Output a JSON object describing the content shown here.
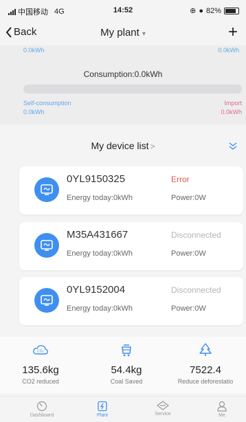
{
  "status_bar": {
    "carrier": "中国移动",
    "network": "4G",
    "time": "14:52",
    "battery": "82%",
    "battery_level": 0.82
  },
  "nav": {
    "back_label": "Back",
    "title": "My plant",
    "plus": "+"
  },
  "summary": {
    "top_left_value": "0.0kWh",
    "top_right_value": "0.0kWh",
    "consumption": "Consumption:0.0kWh",
    "self_consumption_label": "Self-consumption",
    "self_consumption_value": "0.0kWh",
    "import_label": "Import",
    "import_value": "0.0kWh",
    "colors": {
      "blue": "#5fa8e6",
      "pink": "#e06a8a"
    }
  },
  "device_list": {
    "title": "My device list",
    "chevron": ">",
    "devices": [
      {
        "serial": "0YL9150325",
        "status": "Error",
        "status_color": "#e05a4e",
        "energy": "Energy today:0kWh",
        "power": "Power:0W"
      },
      {
        "serial": "M35A431667",
        "status": "Disconnected",
        "status_color": "#b5b5b5",
        "energy": "Energy today:0kWh",
        "power": "Power:0W"
      },
      {
        "serial": "0YL9152004",
        "status": "Disconnected",
        "status_color": "#b5b5b5",
        "energy": "Energy today:0kWh",
        "power": "Power:0W"
      }
    ]
  },
  "stats": [
    {
      "icon": "cloud-co2-icon",
      "value": "135.6kg",
      "label": "CO2 reduced"
    },
    {
      "icon": "coal-cart-icon",
      "value": "54.4kg",
      "label": "Coal Saved"
    },
    {
      "icon": "tree-icon",
      "value": "7522.4",
      "label": "Reduce deforestatio"
    }
  ],
  "tabs": [
    {
      "icon": "dashboard-icon",
      "label": "Dashboard",
      "active": false
    },
    {
      "icon": "plant-icon",
      "label": "Plant",
      "active": true
    },
    {
      "icon": "service-icon",
      "label": "Service",
      "active": false
    },
    {
      "icon": "me-icon",
      "label": "Me",
      "active": false
    }
  ],
  "accent_color": "#3f8ff0"
}
